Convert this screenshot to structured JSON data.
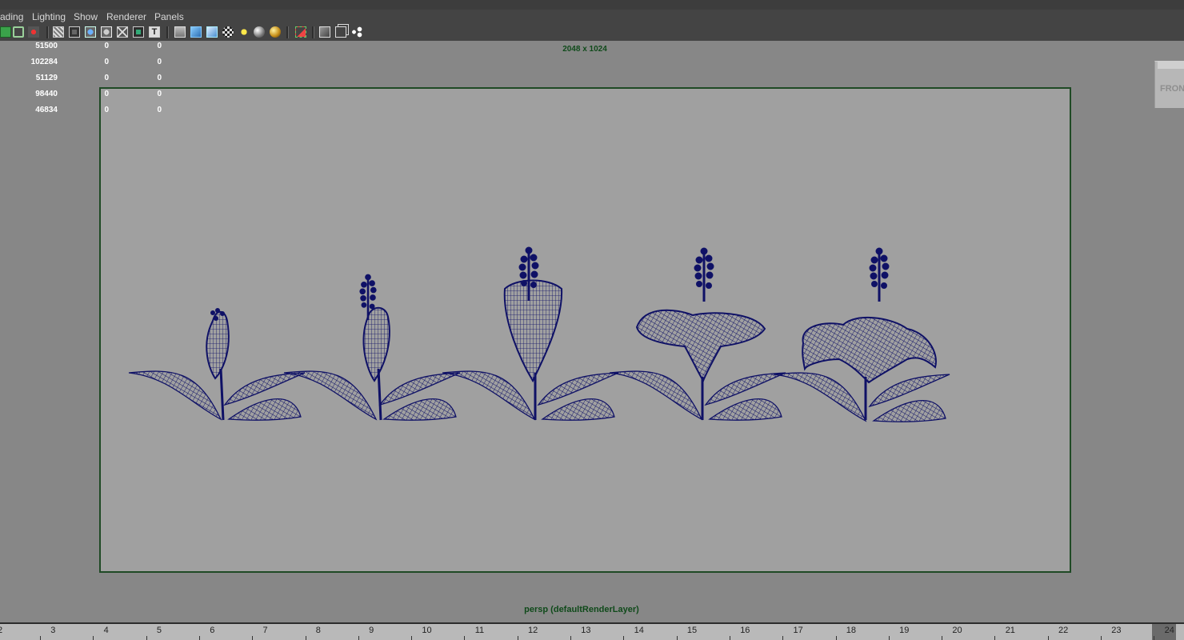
{
  "menubar": {
    "items": [
      "ading",
      "Lighting",
      "Show",
      "Renderer",
      "Panels"
    ]
  },
  "toolbar": {
    "icons": [
      "select-icon",
      "lasso-icon",
      "paint-icon",
      "wireframe-icon",
      "film-gate-icon",
      "smooth-shade-icon",
      "smooth-wire-icon",
      "xray-icon",
      "textured-icon",
      "text-icon",
      "camera-cube-icon",
      "shaded-cube-icon",
      "cube-box-icon",
      "checker-icon",
      "light-icon",
      "sphere-icon",
      "gold-sphere-icon",
      "isolate-select-icon",
      "cube-icon",
      "duplicate-icon",
      "node-icon"
    ]
  },
  "hud": {
    "rows": [
      [
        "51500",
        "0",
        "0"
      ],
      [
        "102284",
        "0",
        "0"
      ],
      [
        "51129",
        "0",
        "0"
      ],
      [
        "98440",
        "0",
        "0"
      ],
      [
        "46834",
        "0",
        "0"
      ]
    ]
  },
  "viewport": {
    "resolution_label": "2048 x 1024",
    "camera_label": "persp (defaultRenderLayer)",
    "viewcube_label": "FRONT",
    "wire_color": "#0f1166",
    "gate_color": "#1f4a25"
  },
  "timeline": {
    "ticks": [
      "2",
      "3",
      "4",
      "5",
      "6",
      "7",
      "8",
      "9",
      "10",
      "11",
      "12",
      "13",
      "14",
      "15",
      "16",
      "17",
      "18",
      "19",
      "20",
      "21",
      "22",
      "23",
      "24"
    ]
  }
}
